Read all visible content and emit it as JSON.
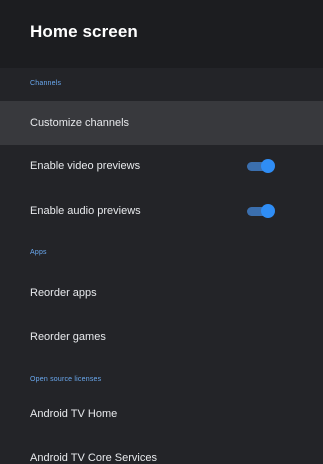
{
  "header": {
    "title": "Home screen"
  },
  "sections": {
    "channels": "Channels",
    "apps": "Apps",
    "licenses": "Open source licenses"
  },
  "items": {
    "customize_channels": "Customize channels",
    "enable_video_previews": "Enable video previews",
    "enable_audio_previews": "Enable audio previews",
    "reorder_apps": "Reorder apps",
    "reorder_games": "Reorder games",
    "android_tv_home": "Android TV Home",
    "android_tv_core_services": "Android TV Core Services"
  },
  "toggles": {
    "video_previews_on": true,
    "audio_previews_on": true
  },
  "colors": {
    "accent": "#2f8df5",
    "section_header": "#6aa9f0",
    "focused_row": "#38393d",
    "background": "#232428"
  }
}
